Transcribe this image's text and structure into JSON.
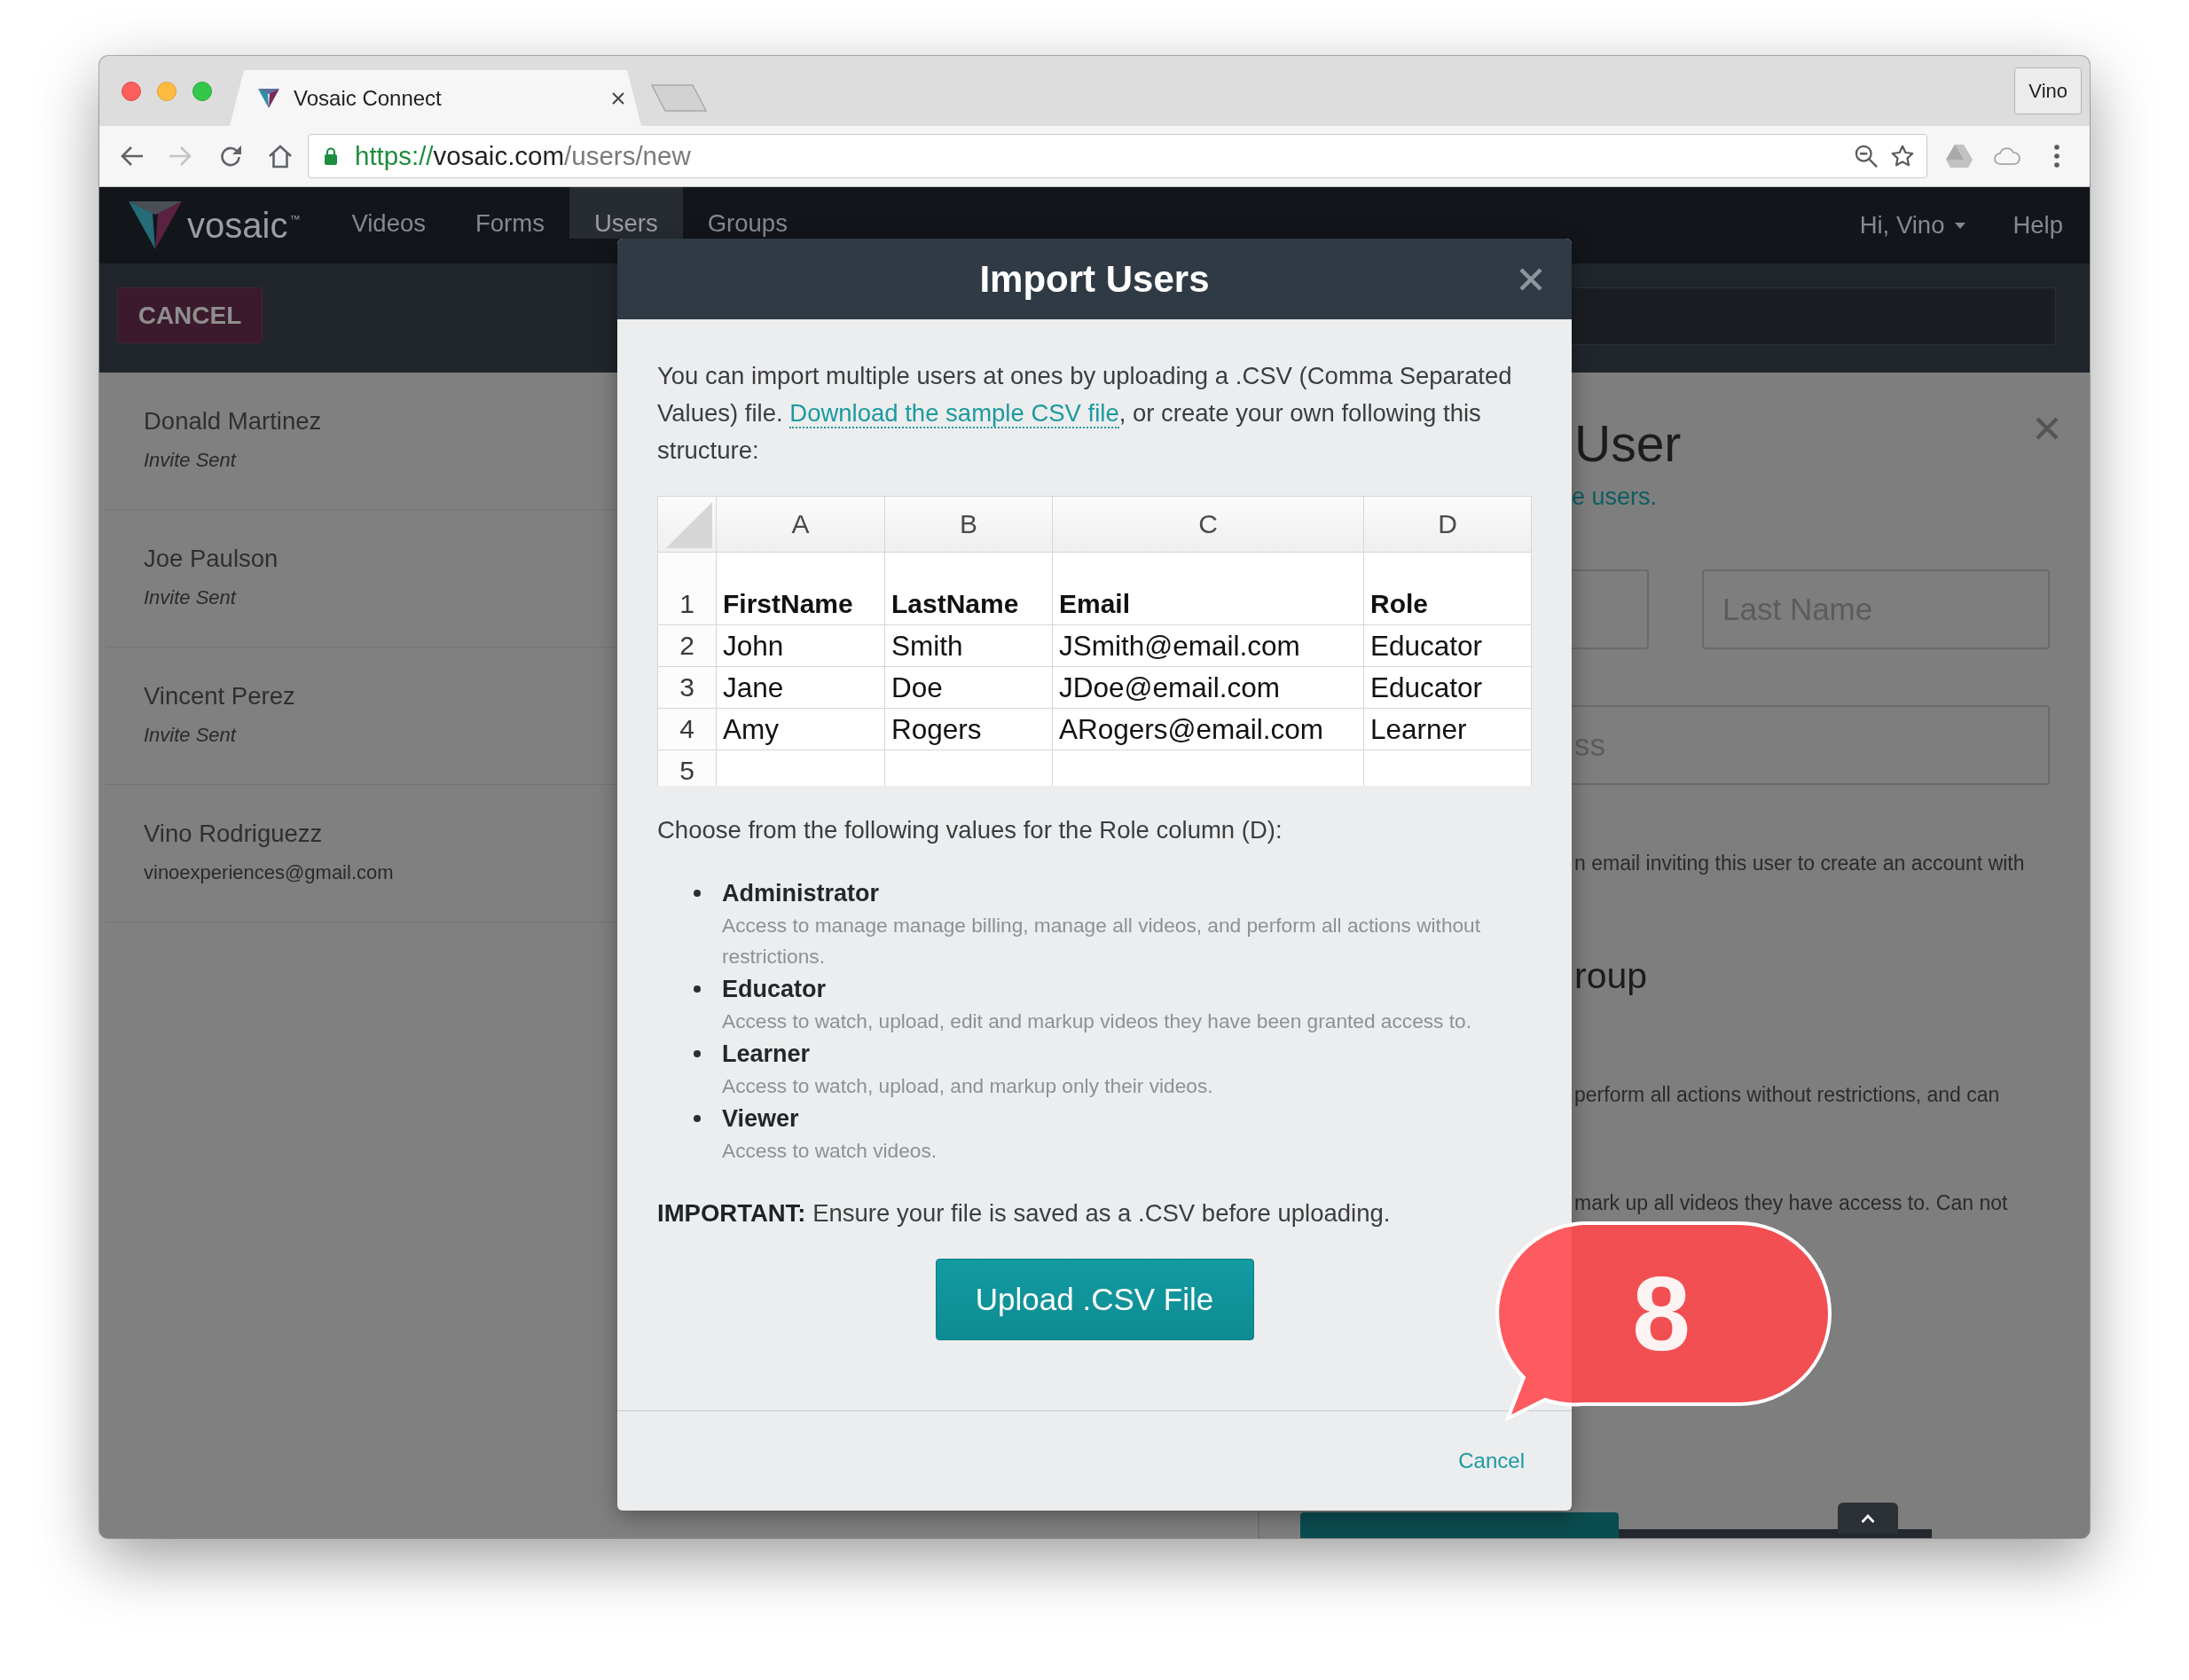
{
  "browser": {
    "tabs": [
      {
        "title": "Vosaic Connect",
        "selected": true
      }
    ],
    "profile": "Vino",
    "nav_buttons": [
      {
        "kind": "back",
        "disabled": false
      },
      {
        "kind": "forward",
        "disabled": true
      },
      {
        "kind": "reload",
        "disabled": false
      },
      {
        "kind": "home",
        "disabled": false
      }
    ],
    "url": {
      "scheme": "https://",
      "host": "vosaic.com",
      "path": "/users/new"
    }
  },
  "app": {
    "logo": "vosaic$^{™}$",
    "nav": [
      {
        "label": "Videos",
        "selected": false
      },
      {
        "label": "Forms",
        "selected": false
      },
      {
        "label": "Users",
        "selected": true
      },
      {
        "label": "Groups",
        "selected": false
      }
    ],
    "user_menu": "Hi, Vino",
    "help": "Help",
    "cancel_button": "CANCEL"
  },
  "users": [
    {
      "name": "Donald Martinez",
      "status": "Invite Sent"
    },
    {
      "name": "Joe Paulson",
      "status": "Invite Sent"
    },
    {
      "name": "Vincent Perez",
      "status": "Invite Sent"
    },
    {
      "name": "Vino Rodriguezz",
      "email": "vinoexperiences@gmail.com"
    }
  ],
  "new_user_panel": {
    "title": "User",
    "link": "e users.",
    "fields": [
      {
        "kind": "pair",
        "placeholder": "Last Name"
      },
      {
        "kind": "single",
        "placeholder": "ss"
      }
    ],
    "note": "n email inviting this user to create an account with",
    "heading": "roup",
    "lines": [
      "perform all actions without restrictions, and can",
      "mark up all videos they have access to. Can not"
    ]
  },
  "modal": {
    "title": "Import Users",
    "intro": {
      "text": "You can import multiple users at ones by uploading a .CSV (Comma Separated Values) file. ",
      "link": "Download the sample CSV file",
      "after": ", or create your own following this structure:"
    },
    "spreadsheet": {
      "columns": [
        "A",
        "B",
        "C",
        "D"
      ],
      "rows": [
        {
          "number": "1",
          "kind": "header",
          "cells": [
            "FirstName",
            "LastName",
            "Email",
            "Role"
          ]
        },
        {
          "number": "2",
          "kind": "data",
          "cells": [
            "John",
            "Smith",
            "JSmith@email.com",
            "Educator"
          ]
        },
        {
          "number": "3",
          "kind": "data",
          "cells": [
            "Jane",
            "Doe",
            "JDoe@email.com",
            "Educator"
          ]
        },
        {
          "number": "4",
          "kind": "data",
          "cells": [
            "Amy",
            "Rogers",
            "ARogers@email.com",
            "Learner"
          ]
        },
        {
          "number": "5",
          "kind": "data"
        }
      ]
    },
    "roles_intro": "Choose from the following values for the Role column (D):",
    "roles": [
      {
        "name": "Administrator",
        "description": "Access to manage manage billing, manage all videos, and perform all actions without restrictions."
      },
      {
        "name": "Educator",
        "description": "Access to watch, upload, edit and markup videos they have been granted access to."
      },
      {
        "name": "Learner",
        "description": "Access to watch, upload, and markup only their videos."
      },
      {
        "name": "Viewer",
        "description": "Access to watch videos."
      }
    ],
    "important": "**IMPORTANT:** Ensure your file is saved as a .CSV before uploading.",
    "upload_button": "Upload .CSV File",
    "cancel_link": "Cancel"
  },
  "callout": {
    "label": "8"
  }
}
